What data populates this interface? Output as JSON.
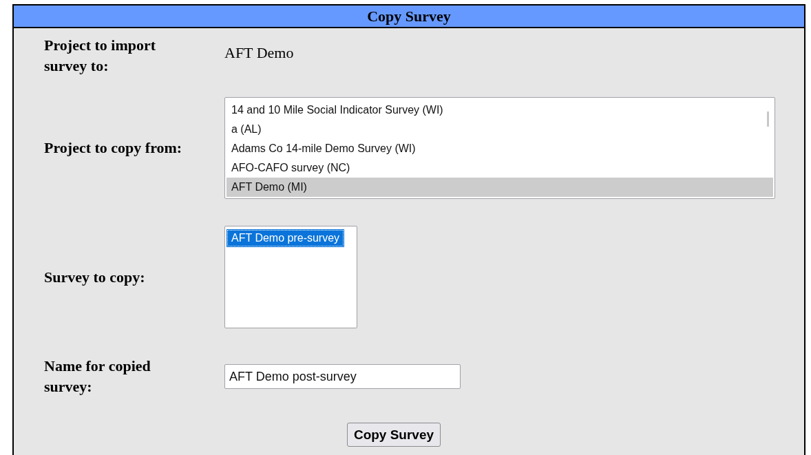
{
  "panel": {
    "title": "Copy Survey"
  },
  "fields": [
    {
      "kind": "text",
      "label": "Project to import survey to:",
      "value": "AFT Demo"
    },
    {
      "kind": "listbox",
      "label": "Project to copy from:",
      "focused": false,
      "scrollable": true,
      "options": [
        {
          "label": "14 and 10 Mile Social Indicator Survey (WI)",
          "selected": false
        },
        {
          "label": "a (AL)",
          "selected": false
        },
        {
          "label": "Adams Co 14-mile Demo Survey (WI)",
          "selected": false
        },
        {
          "label": "AFO-CAFO survey (NC)",
          "selected": false
        },
        {
          "label": "AFT Demo (MI)",
          "selected": true
        }
      ]
    },
    {
      "kind": "listbox",
      "label": "Survey to copy:",
      "focused": true,
      "options": [
        {
          "label": "AFT Demo pre-survey",
          "selected": true
        }
      ]
    },
    {
      "kind": "input",
      "label": "Name for copied survey:",
      "value": "AFT Demo post-survey"
    }
  ],
  "submit": {
    "label": "Copy Survey"
  }
}
